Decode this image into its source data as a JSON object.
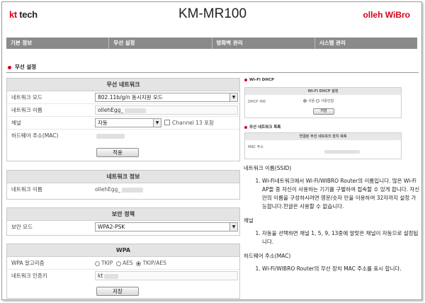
{
  "header": {
    "brand_left_kt": "kt",
    "brand_left_rest": " tech",
    "model": "KM-MR100",
    "brand_right": "olleh WiBro"
  },
  "nav": [
    "기본 정보",
    "무선 설정",
    "방화벽 관리",
    "시스템 관리"
  ],
  "section_title": "무선 설정",
  "wireless": {
    "title": "무선 네트워크",
    "mode_label": "네트워크 모드",
    "mode_value": "802.11b/g/n 동시지원 모드",
    "name_label": "네트워크 이름",
    "name_value": "ollehEgg_",
    "channel_label": "채널",
    "channel_value": "자동",
    "channel13_label": "Channel 13 포함",
    "mac_label": "하드웨어 주소(MAC)",
    "apply_button": "적용"
  },
  "netinfo": {
    "title": "네트워크 정보",
    "name_label": "네트워크 이름",
    "name_value": "ollehEgg_"
  },
  "security": {
    "title": "보안 정책",
    "mode_label": "보안 모드",
    "mode_value": "WPA2-PSK"
  },
  "wpa": {
    "title": "WPA",
    "algo_label": "WPA 알고리즘",
    "opt1": "TKIP",
    "opt2": "AES",
    "opt3": "TKIP/AES",
    "key_label": "네트워크 인증키",
    "key_value": "kt",
    "save_button": "저장"
  },
  "dhcp": {
    "section": "Wi-Fi DHCP",
    "title": "Wi-Fi DHCP 설정",
    "server_label": "DHCP 서버",
    "opt_use": "사용",
    "opt_nouse": "사용안함",
    "save_button": "저장"
  },
  "devices": {
    "section": "무선 네트워크 목록",
    "title": "연결된 무선 네트워크 장치 목록",
    "mac_label": "MAC 주소"
  },
  "help": {
    "h1": "네트워크 이름(SSID)",
    "p1": "Wi-Fi네트워크에서 Wi-Fi/WIBRO Router의 이름입니다. 많은 Wi-Fi AP들 중 자신이 사용하는 기기를 구별하여 접속할 수 있게 합니다. 자신만의 이름을 구성하시려면 영문/숫자 만을 이용하여 32자까지 설정 가능합니다.한글은 사용할 수 없습니다.",
    "h2": "채널",
    "p2": "자동을 선택하면 채널 1, 5, 9, 13중에 알맞은 채널이 자동으로 설정됩니다.",
    "h3": "하드웨어 주소(MAC)",
    "p3": "Wi-Fi/WIBRO Router의 무선 장치 MAC 주소를 표시 합니다."
  }
}
